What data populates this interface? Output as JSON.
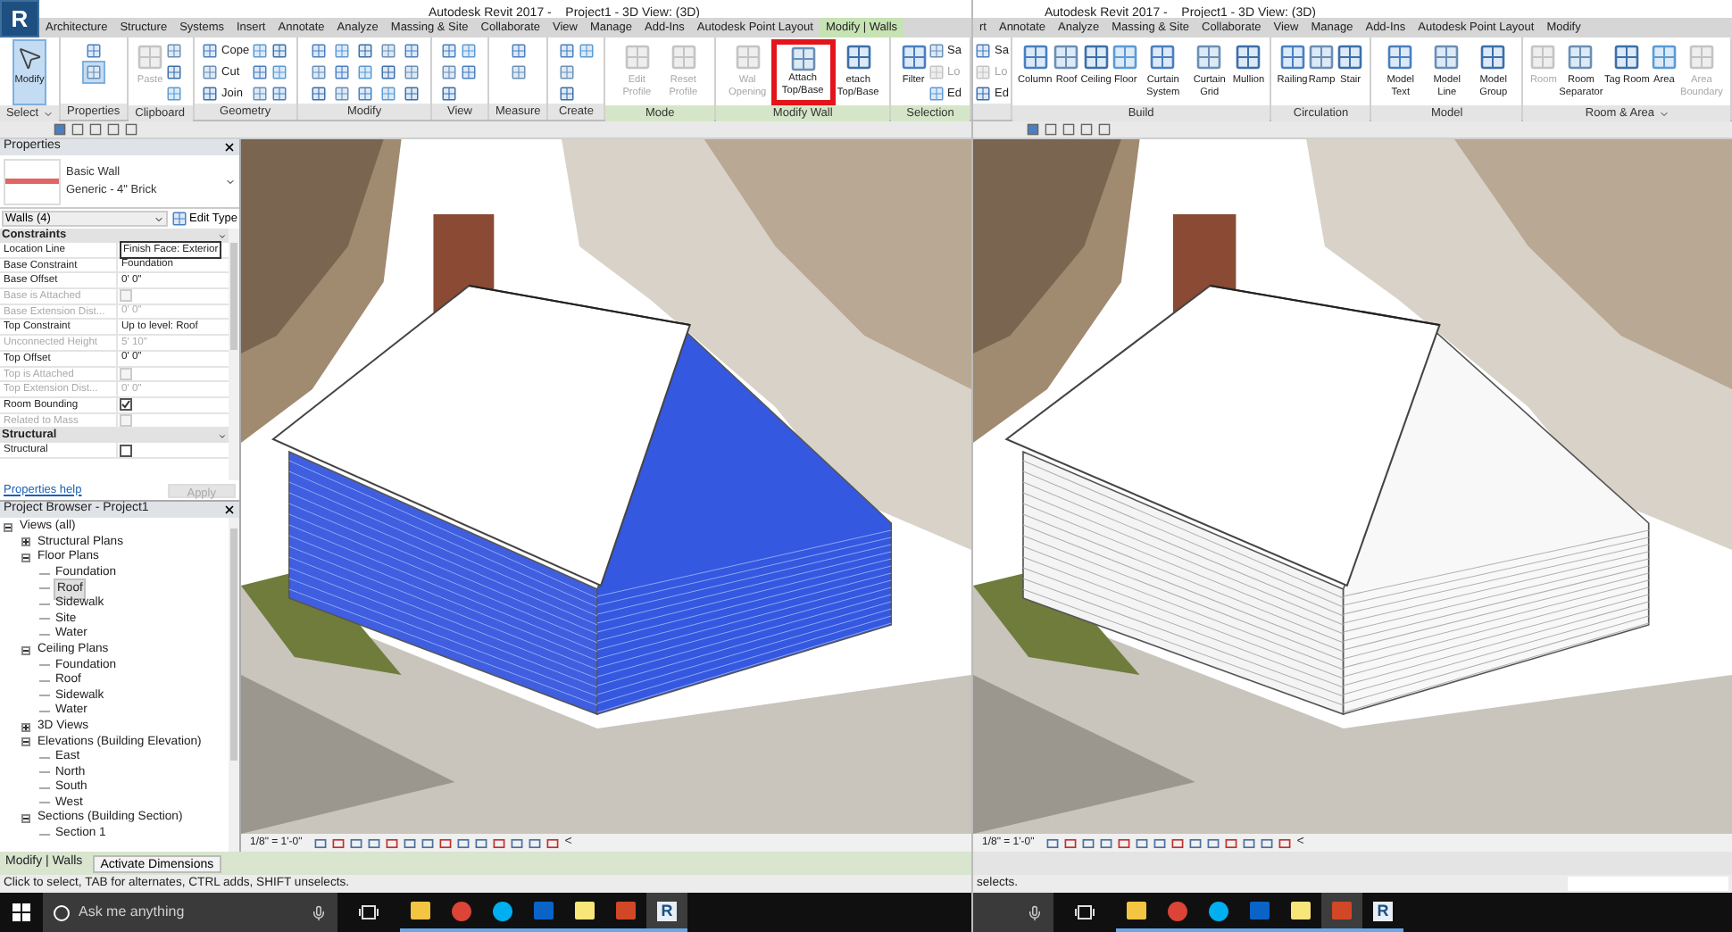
{
  "left": {
    "logo": "R",
    "title": "Autodesk Revit 2017 -    Project1 - 3D View: (3D)",
    "tabs": [
      {
        "label": "Architecture",
        "selected": false
      },
      {
        "label": "Structure",
        "selected": false
      },
      {
        "label": "Systems",
        "selected": false
      },
      {
        "label": "Insert",
        "selected": false
      },
      {
        "label": "Annotate",
        "selected": false
      },
      {
        "label": "Analyze",
        "selected": false
      },
      {
        "label": "Massing & Site",
        "selected": false
      },
      {
        "label": "Collaborate",
        "selected": false
      },
      {
        "label": "View",
        "selected": false
      },
      {
        "label": "Manage",
        "selected": false
      },
      {
        "label": "Add-Ins",
        "selected": false
      },
      {
        "label": "Autodesk Point Layout",
        "selected": false
      },
      {
        "label": "Modify | Walls",
        "selected": true
      }
    ],
    "ribbon": [
      {
        "label": "Select",
        "dropdown": true,
        "contextual": false,
        "tools": [
          {
            "kind": "large",
            "label": "Modify",
            "selected": true
          }
        ]
      },
      {
        "label": "Properties",
        "contextual": false,
        "tools": [
          {
            "kind": "icon"
          },
          {
            "kind": "icon",
            "selected": true
          }
        ]
      },
      {
        "label": "Clipboard",
        "contextual": false,
        "tools": [
          {
            "kind": "large",
            "label": "Paste",
            "disabled": true
          },
          {
            "kind": "icon"
          },
          {
            "kind": "icon"
          },
          {
            "kind": "icon"
          }
        ]
      },
      {
        "label": "Geometry",
        "contextual": false,
        "tools": [
          {
            "kind": "small",
            "label": "Cope"
          },
          {
            "kind": "small",
            "label": "Cut"
          },
          {
            "kind": "small",
            "label": "Join"
          },
          {
            "kind": "icon"
          },
          {
            "kind": "icon"
          },
          {
            "kind": "icon"
          },
          {
            "kind": "icon"
          },
          {
            "kind": "icon"
          },
          {
            "kind": "icon"
          }
        ]
      },
      {
        "label": "Modify",
        "contextual": false,
        "tools": [
          {
            "kind": "icon"
          },
          {
            "kind": "icon"
          },
          {
            "kind": "icon"
          },
          {
            "kind": "icon"
          },
          {
            "kind": "icon"
          },
          {
            "kind": "icon"
          },
          {
            "kind": "icon"
          },
          {
            "kind": "icon"
          },
          {
            "kind": "icon"
          },
          {
            "kind": "icon"
          },
          {
            "kind": "icon"
          },
          {
            "kind": "icon"
          },
          {
            "kind": "icon"
          },
          {
            "kind": "icon"
          },
          {
            "kind": "icon"
          }
        ]
      },
      {
        "label": "View",
        "contextual": false,
        "tools": [
          {
            "kind": "icon"
          },
          {
            "kind": "icon"
          },
          {
            "kind": "icon"
          },
          {
            "kind": "icon"
          },
          {
            "kind": "icon"
          }
        ]
      },
      {
        "label": "Measure",
        "contextual": false,
        "tools": [
          {
            "kind": "icon"
          },
          {
            "kind": "icon"
          }
        ]
      },
      {
        "label": "Create",
        "contextual": false,
        "tools": [
          {
            "kind": "icon"
          },
          {
            "kind": "icon"
          },
          {
            "kind": "icon"
          },
          {
            "kind": "icon"
          }
        ]
      },
      {
        "label": "Mode",
        "contextual": true,
        "tools": [
          {
            "kind": "large",
            "label": "Edit Profile",
            "disabled": true
          },
          {
            "kind": "large",
            "label": "Reset Profile",
            "disabled": true
          }
        ]
      },
      {
        "label": "Modify Wall",
        "contextual": true,
        "tools": [
          {
            "kind": "large",
            "label": "Wal Opening",
            "disabled": true
          },
          {
            "kind": "large",
            "label": "Attach Top/Base",
            "disabled": false,
            "highlighted": true
          },
          {
            "kind": "large",
            "label": "etach Top/Base",
            "disabled": false
          }
        ]
      },
      {
        "label": "Selection",
        "contextual": true,
        "tools": [
          {
            "kind": "large",
            "label": "Filter"
          },
          {
            "kind": "small",
            "label": "Sa"
          },
          {
            "kind": "small",
            "label": "Lo",
            "disabled": true
          },
          {
            "kind": "small",
            "label": "Ed"
          }
        ]
      }
    ],
    "properties": {
      "title": "Properties",
      "type_name": "Basic Wall",
      "type_detail": "Generic - 4\" Brick",
      "selector": "Walls (4)",
      "edit_type": "Edit Type",
      "groups": [
        {
          "label": "Constraints",
          "rows": [
            {
              "kind": "text",
              "name": "Location Line",
              "value": "Finish Face: Exterior",
              "disabled": false,
              "editing": true
            },
            {
              "kind": "text",
              "name": "Base Constraint",
              "value": "Foundation",
              "disabled": false
            },
            {
              "kind": "text",
              "name": "Base Offset",
              "value": "0'  0\"",
              "disabled": false
            },
            {
              "kind": "checkbox",
              "name": "Base is Attached",
              "checked": false,
              "disabled": true
            },
            {
              "kind": "text",
              "name": "Base Extension Dist...",
              "value": "0'  0\"",
              "disabled": true
            },
            {
              "kind": "text",
              "name": "Top Constraint",
              "value": "Up to level: Roof",
              "disabled": false
            },
            {
              "kind": "text",
              "name": "Unconnected Height",
              "value": "5'  10\"",
              "disabled": true
            },
            {
              "kind": "text",
              "name": "Top Offset",
              "value": "0'  0\"",
              "disabled": false
            },
            {
              "kind": "checkbox",
              "name": "Top is Attached",
              "checked": false,
              "disabled": true
            },
            {
              "kind": "text",
              "name": "Top Extension Dist...",
              "value": "0'  0\"",
              "disabled": true
            },
            {
              "kind": "checkbox",
              "name": "Room Bounding",
              "checked": true,
              "disabled": false
            },
            {
              "kind": "checkbox",
              "name": "Related to Mass",
              "checked": false,
              "disabled": true
            }
          ]
        },
        {
          "label": "Structural",
          "rows": [
            {
              "kind": "checkbox",
              "name": "Structural",
              "checked": false,
              "disabled": false
            }
          ]
        }
      ],
      "help": "Properties help",
      "apply": {
        "label": "Apply",
        "disabled": true
      }
    },
    "browser": {
      "title": "Project Browser - Project1",
      "tree": [
        {
          "label": "Views (all)",
          "expanded": true,
          "selected": false,
          "children": [
            {
              "label": "Structural Plans",
              "expanded": false,
              "selected": false
            },
            {
              "label": "Floor Plans",
              "expanded": true,
              "selected": false,
              "children": [
                {
                  "label": "Foundation",
                  "selected": false
                },
                {
                  "label": "Roof",
                  "selected": true
                },
                {
                  "label": "Sidewalk",
                  "selected": false
                },
                {
                  "label": "Site",
                  "selected": false
                },
                {
                  "label": "Water",
                  "selected": false
                }
              ]
            },
            {
              "label": "Ceiling Plans",
              "expanded": true,
              "selected": false,
              "children": [
                {
                  "label": "Foundation",
                  "selected": false
                },
                {
                  "label": "Roof",
                  "selected": false
                },
                {
                  "label": "Sidewalk",
                  "selected": false
                },
                {
                  "label": "Water",
                  "selected": false
                }
              ]
            },
            {
              "label": "3D Views",
              "expanded": false,
              "selected": false
            },
            {
              "label": "Elevations (Building Elevation)",
              "expanded": true,
              "selected": false,
              "children": [
                {
                  "label": "East",
                  "selected": false
                },
                {
                  "label": "North",
                  "selected": false
                },
                {
                  "label": "South",
                  "selected": false
                },
                {
                  "label": "West",
                  "selected": false
                }
              ]
            },
            {
              "label": "Sections (Building Section)",
              "expanded": true,
              "selected": false,
              "children": [
                {
                  "label": "Section 1",
                  "selected": false
                }
              ]
            }
          ]
        }
      ]
    },
    "viewport": {
      "walls_selected": true
    },
    "view_bar": {
      "scale": "1/8\" = 1'-0\"",
      "more": "<"
    },
    "context_bar": {
      "label": "Modify | Walls",
      "button": "Activate Dimensions"
    },
    "status": "Click to select, TAB for alternates, CTRL adds, SHIFT unselects.",
    "taskbar": {
      "search_placeholder": "Ask me anything",
      "apps": [
        {
          "kind": "folder",
          "active": false
        },
        {
          "kind": "chrome",
          "active": false
        },
        {
          "kind": "skype",
          "active": false
        },
        {
          "kind": "outlook",
          "active": false
        },
        {
          "kind": "notes",
          "active": false
        },
        {
          "kind": "powerpoint",
          "active": false
        },
        {
          "kind": "revit",
          "letter": "R",
          "active": true
        }
      ]
    }
  },
  "right": {
    "title": "Autodesk Revit 2017 -    Project1 - 3D View: (3D)",
    "tabs": [
      {
        "label": "rt",
        "selected": false
      },
      {
        "label": "Annotate",
        "selected": false
      },
      {
        "label": "Analyze",
        "selected": false
      },
      {
        "label": "Massing & Site",
        "selected": false
      },
      {
        "label": "Collaborate",
        "selected": false
      },
      {
        "label": "View",
        "selected": false
      },
      {
        "label": "Manage",
        "selected": false
      },
      {
        "label": "Add-Ins",
        "selected": false
      },
      {
        "label": "Autodesk Point Layout",
        "selected": false
      },
      {
        "label": "Modify",
        "selected": false
      }
    ],
    "ribbon": [
      {
        "contextual": false,
        "tools": [
          {
            "kind": "small",
            "label": "Sa"
          },
          {
            "kind": "small",
            "label": "Lo",
            "disabled": true
          },
          {
            "kind": "small",
            "label": "Ed"
          }
        ]
      },
      {
        "label": "Build",
        "contextual": false,
        "tools": [
          {
            "kind": "large",
            "label": "Column"
          },
          {
            "kind": "large",
            "label": "Roof"
          },
          {
            "kind": "large",
            "label": "Ceiling"
          },
          {
            "kind": "large",
            "label": "Floor"
          },
          {
            "kind": "large",
            "label": "Curtain System"
          },
          {
            "kind": "large",
            "label": "Curtain Grid"
          },
          {
            "kind": "large",
            "label": "Mullion"
          }
        ]
      },
      {
        "label": "Circulation",
        "contextual": false,
        "tools": [
          {
            "kind": "large",
            "label": "Railing"
          },
          {
            "kind": "large",
            "label": "Ramp"
          },
          {
            "kind": "large",
            "label": "Stair"
          }
        ]
      },
      {
        "label": "Model",
        "contextual": false,
        "tools": [
          {
            "kind": "large",
            "label": "Model Text"
          },
          {
            "kind": "large",
            "label": "Model Line"
          },
          {
            "kind": "large",
            "label": "Model Group"
          }
        ]
      },
      {
        "label": "Room & Area",
        "dropdown": true,
        "contextual": false,
        "tools": [
          {
            "kind": "large",
            "label": "Room",
            "disabled": true
          },
          {
            "kind": "large",
            "label": "Room Separator"
          },
          {
            "kind": "large",
            "label": "Tag Room"
          },
          {
            "kind": "large",
            "label": "Area"
          },
          {
            "kind": "large",
            "label": "Area Boundary",
            "disabled": true
          }
        ]
      }
    ],
    "viewport": {
      "walls_selected": false
    },
    "view_bar": {
      "scale": "1/8\" = 1'-0\"",
      "more": "<"
    },
    "status": "selects.",
    "taskbar": {
      "apps": [
        {
          "kind": "folder",
          "active": false
        },
        {
          "kind": "chrome",
          "active": false
        },
        {
          "kind": "skype",
          "active": false
        },
        {
          "kind": "outlook",
          "active": false
        },
        {
          "kind": "notes",
          "active": false
        },
        {
          "kind": "powerpoint",
          "active": true
        },
        {
          "kind": "revit",
          "letter": "R",
          "active": false
        }
      ]
    }
  }
}
